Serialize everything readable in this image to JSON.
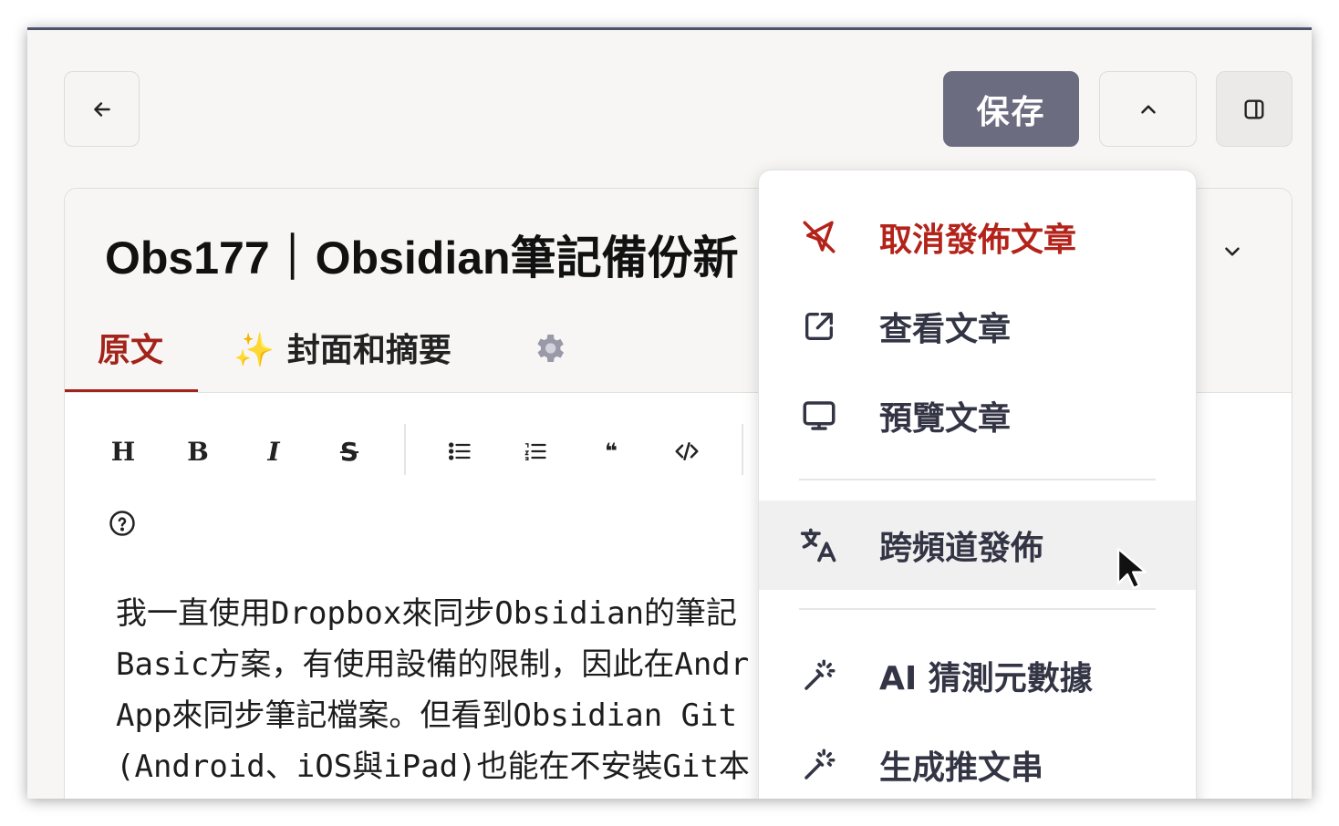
{
  "toolbar": {
    "back_icon": "arrow-left-icon",
    "save_label": "保存",
    "collapse_icon": "chevron-up-icon",
    "panel_icon": "sidebar-panel-icon"
  },
  "article": {
    "title": "Obs177｜Obsidian筆記備份新"
  },
  "tabs": [
    {
      "label": "原文",
      "active": true
    },
    {
      "label": "封面和摘要",
      "icon": "sparkles-icon",
      "icon_glyph": "✨"
    },
    {
      "icon": "gear-icon"
    }
  ],
  "editor_toolbar": {
    "buttons": [
      "heading-icon",
      "bold-icon",
      "italic-icon",
      "strikethrough-icon",
      "bullet-list-icon",
      "numbered-list-icon",
      "quote-icon",
      "code-icon",
      "help-icon"
    ],
    "glyphs": {
      "heading": "H",
      "bold": "B",
      "italic": "I",
      "strike": "S",
      "quote": "❝"
    }
  },
  "content": {
    "lines": [
      "我一直使用Dropbox來同步Obsidian的筆記",
      "Basic方案，有使用設備的限制，因此在Andr",
      "App來同步筆記檔案。但看到Obsidian Git",
      "(Android、iOS與iPad)也能在不安裝Git本"
    ]
  },
  "menu": {
    "items": [
      {
        "label": "取消發佈文章",
        "icon": "unpublish-send-icon",
        "danger": true
      },
      {
        "label": "查看文章",
        "icon": "external-link-icon"
      },
      {
        "label": "預覽文章",
        "icon": "monitor-icon"
      },
      {
        "label": "跨頻道發佈",
        "icon": "translate-icon",
        "hovered": true
      },
      {
        "label": "AI 猜測元數據",
        "icon": "magic-wand-icon"
      },
      {
        "label": "生成推文串",
        "icon": "magic-wand-icon"
      }
    ]
  },
  "colors": {
    "accent_red": "#b3231a",
    "save_bg": "#6b6c80",
    "window_border": "#4b5468"
  }
}
